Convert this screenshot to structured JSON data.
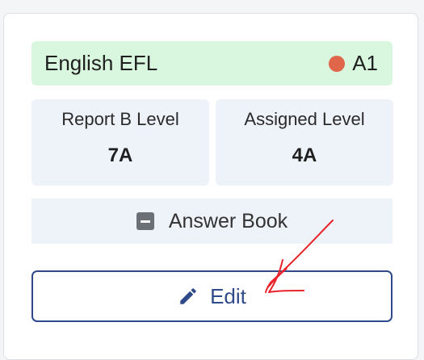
{
  "subject": {
    "name": "English EFL",
    "level_code": "A1",
    "status_color": "#e0664a",
    "background_color": "#d9f7df"
  },
  "stats": [
    {
      "label": "Report B Level",
      "value": "7A"
    },
    {
      "label": "Assigned Level",
      "value": "4A"
    }
  ],
  "answer_book": {
    "label": "Answer Book",
    "icon": "minus-square-icon"
  },
  "edit_button": {
    "label": "Edit",
    "icon": "pencil-icon",
    "accent_color": "#2f4a8a"
  },
  "annotation": {
    "icon": "red-arrow-icon",
    "color": "#e8232a"
  }
}
